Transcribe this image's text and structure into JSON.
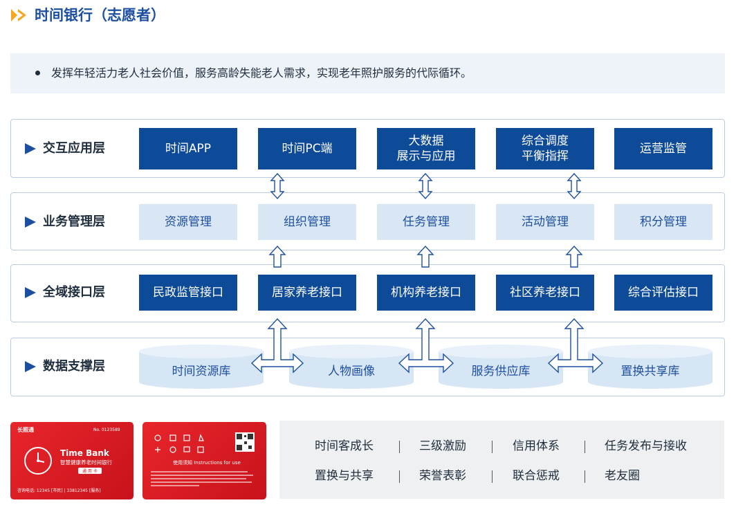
{
  "header": {
    "title": "时间银行（志愿者）",
    "accent_color": "#1d4fa0",
    "icon": "double-chevron-right-icon"
  },
  "intro": {
    "text": "发挥年轻活力老人社会价值，服务高龄失能老人需求，实现老年照护服务的代际循环。"
  },
  "layers": [
    {
      "label": "交互应用层",
      "style": "dark",
      "items": [
        "时间APP",
        "时间PC端",
        "大数据\n展示与应用",
        "综合调度\n平衡指挥",
        "运营监管"
      ]
    },
    {
      "label": "业务管理层",
      "style": "light",
      "items": [
        "资源管理",
        "组织管理",
        "任务管理",
        "活动管理",
        "积分管理"
      ]
    },
    {
      "label": "全域接口层",
      "style": "dark",
      "items": [
        "民政监管接口",
        "居家养老接口",
        "机构养老接口",
        "社区养老接口",
        "综合评估接口"
      ]
    },
    {
      "label": "数据支撑层",
      "style": "cylinder",
      "items": [
        "时间资源库",
        "人物画像",
        "服务供应库",
        "置换共享库"
      ]
    }
  ],
  "cards": {
    "front": {
      "brand": "长照通",
      "number": "No. 0123589",
      "title": "Time Bank",
      "subtitle": "智慧健康养老时间银行",
      "tag": "通 用 卡",
      "hotline": "咨询电话: 12345 [市民] | 33812345 [服务]"
    },
    "back": {
      "notice": "使用须知  Instructions for use"
    }
  },
  "features": {
    "row1": [
      "时间客成长",
      "三级激励",
      "信用体系",
      "任务发布与接收"
    ],
    "row2": [
      "置换与共享",
      "荣誉表彰",
      "联合惩戒",
      "老友圈"
    ]
  },
  "colors": {
    "dark_box": "#0d4a98",
    "light_box": "#d9e7f5",
    "layer_border": "#b9cde6",
    "card_red": "#d81e25",
    "panel_bg": "#eef0f2"
  }
}
